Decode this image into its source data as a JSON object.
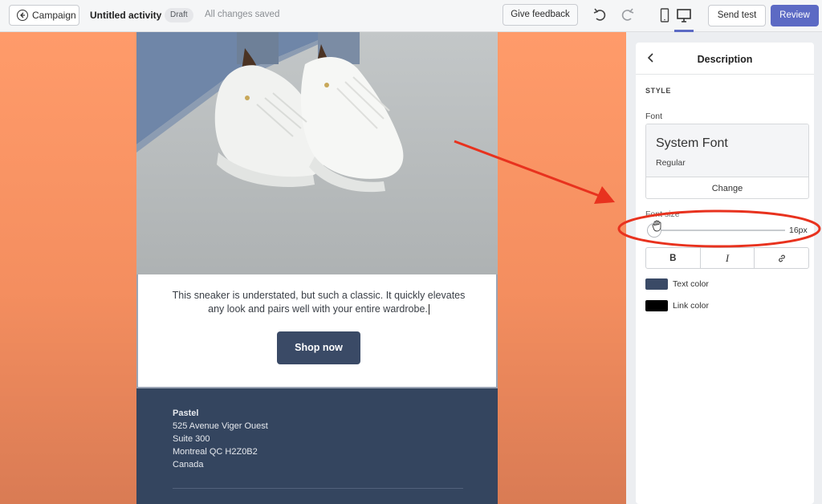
{
  "topbar": {
    "back_label": "Campaign",
    "activity_title": "Untitled activity",
    "status_badge": "Draft",
    "save_status": "All changes saved",
    "feedback_label": "Give feedback",
    "send_test_label": "Send test",
    "review_label": "Review"
  },
  "email": {
    "description": "This sneaker is understated, but such a classic. It quickly elevates any look and pairs well with your entire wardrobe.",
    "button_label": "Shop now",
    "footer": {
      "company": "Pastel",
      "address_lines": [
        "525 Avenue Viger Ouest",
        "Suite 300",
        "Montreal QC H2Z0B2",
        "Canada"
      ]
    }
  },
  "sidebar": {
    "title": "Description",
    "section_heading": "STYLE",
    "font_label": "Font",
    "font_name": "System Font",
    "font_weight": "Regular",
    "change_label": "Change",
    "font_size_label": "Font size",
    "font_size_value": "16px",
    "font_size_slider_level": 0.0,
    "format_buttons": [
      "B",
      "I",
      "link"
    ],
    "text_color_label": "Text color",
    "text_color": "#3a4a66",
    "link_color_label": "Link color",
    "link_color": "#000000"
  },
  "colors": {
    "accent": "#5c6ac4",
    "canvas_background": "#ff9b6a",
    "annotation": "#e8321e"
  }
}
